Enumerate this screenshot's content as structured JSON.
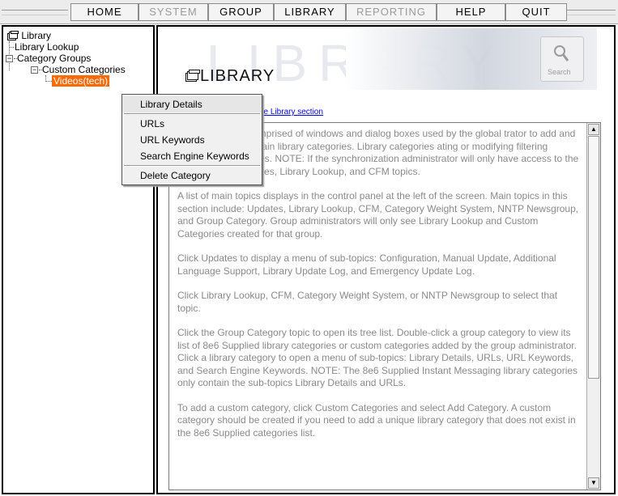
{
  "menu": {
    "items": [
      {
        "label": "HOME",
        "enabled": true
      },
      {
        "label": "SYSTEM",
        "enabled": false
      },
      {
        "label": "GROUP",
        "enabled": true
      },
      {
        "label": "LIBRARY",
        "enabled": true
      },
      {
        "label": "REPORTING",
        "enabled": false
      },
      {
        "label": "HELP",
        "enabled": true
      },
      {
        "label": "QUIT",
        "enabled": true
      }
    ]
  },
  "tree": {
    "root": "Library",
    "lookup": "Library Lookup",
    "category_groups": "Category Groups",
    "custom_categories": "Custom Categories",
    "selected_item": "Videos(tech)",
    "expander_symbol": "−"
  },
  "context_menu": {
    "items": [
      "Library Details",
      "URLs",
      "URL Keywords",
      "Search Engine Keywords",
      "Delete Category"
    ]
  },
  "banner": {
    "watermark": "LIBRARY",
    "title": "LIBRARY",
    "search_label": "Search"
  },
  "link_text": "he Library section",
  "content": {
    "paragraphs": [
      "is comprised of windows and dialog boxes used by the global trator to add and maintain library categories. Library categories ating or modifying filtering profiles. NOTE: If the synchronization administrator will only have access to the Updates, Library Lookup, and CFM topics.",
      "A list of main topics displays in the control panel at the left of the screen. Main topics in this section include: Updates, Library Lookup, CFM, Category Weight System, NNTP Newsgroup, and Group Category. Group administrators will only see Library Lookup and Custom Categories created for that group.",
      "Click Updates to display a menu of sub-topics: Configuration, Manual Update, Additional Language Support, Library Update Log, and Emergency Update Log.",
      "Click Library Lookup, CFM, Category Weight System, or NNTP Newsgroup to select that topic.",
      "Click the Group Category topic to open its tree list. Double-click a group category to view its list of 8e6 Supplied library categories or custom categories added by the group administrator. Click a library category to open a menu of sub-topics: Library Details, URLs, URL Keywords, and Search Engine Keywords. NOTE: The 8e6 Supplied Instant Messaging library categories only contain the sub-topics Library Details and URLs.",
      "To add a custom category, click Custom Categories and select Add Category. A custom category should be created if you need to add a unique library category that does not exist in the 8e6 Supplied categories list."
    ]
  },
  "colors": {
    "selected_bg": "#ff6a00",
    "link": "#0000ee",
    "body_text": "#8a8a8a"
  }
}
